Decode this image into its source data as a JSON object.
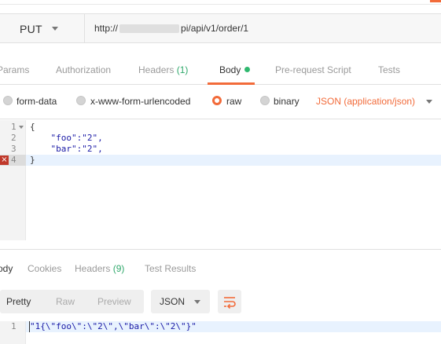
{
  "request": {
    "method": "PUT",
    "url_prefix": "http://",
    "url_suffix": "pi/api/v1/order/1"
  },
  "tabs": [
    {
      "label": "Params"
    },
    {
      "label": "Authorization"
    },
    {
      "label": "Headers",
      "count": "(1)"
    },
    {
      "label": "Body"
    },
    {
      "label": "Pre-request Script"
    },
    {
      "label": "Tests"
    }
  ],
  "body_options": {
    "form_data": "form-data",
    "urlencoded": "x-www-form-urlencoded",
    "raw": "raw",
    "binary": "binary",
    "content_type": "JSON (application/json)",
    "selected": "raw"
  },
  "editor": {
    "line_numbers": [
      "1",
      "2",
      "3",
      "4"
    ],
    "lines": [
      "{",
      "    \"foo\":\"2\",",
      "    \"bar\":\"2\",",
      "}"
    ],
    "error_icon": "x-icon"
  },
  "response": {
    "tabs": [
      {
        "label": "ody"
      },
      {
        "label": "Cookies"
      },
      {
        "label": "Headers",
        "count": "(9)"
      },
      {
        "label": "Test Results"
      }
    ],
    "view_buttons": [
      "Pretty",
      "Raw",
      "Preview"
    ],
    "format": "JSON",
    "line_number": "1",
    "line": "\"1{\\\"foo\\\":\\\"2\\\",\\\"bar\\\":\\\"2\\\"}\""
  },
  "colors": {
    "accent": "#f26b3a",
    "status_green": "#2fb86f",
    "error_red": "#c0392b"
  }
}
